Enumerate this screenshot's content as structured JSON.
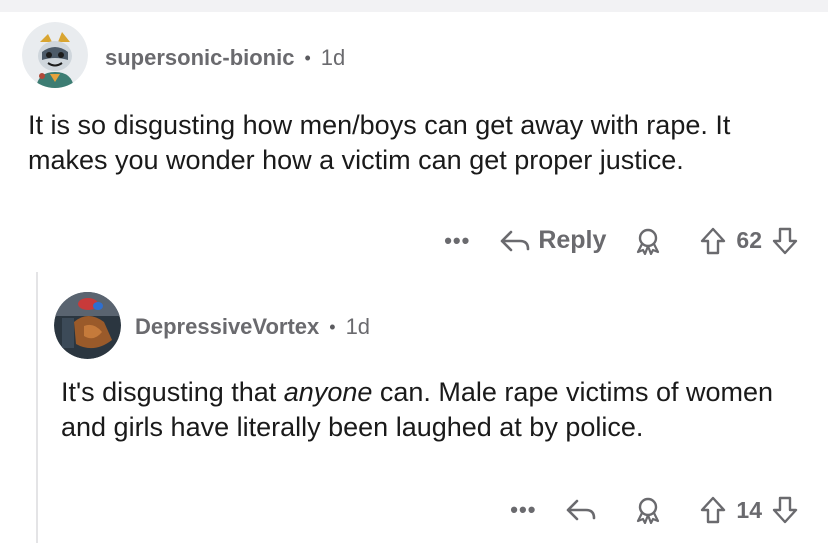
{
  "comments": [
    {
      "username": "supersonic-bionic",
      "separator": "•",
      "age": "1d",
      "text": "It is so disgusting how men/boys can get away with rape. It makes you wonder how a victim can get proper justice.",
      "more_label": "•••",
      "reply_label": "Reply",
      "score": "62"
    },
    {
      "username": "DepressiveVortex",
      "separator": "•",
      "age": "1d",
      "text_before": "It's disgusting that ",
      "text_em": "anyone",
      "text_after": " can. Male rape victims of women and girls have literally been laughed at by police.",
      "more_label": "•••",
      "score": "14"
    }
  ],
  "icons": {
    "reply": "reply-arrow-icon",
    "award": "award-icon",
    "upvote": "upvote-arrow-icon",
    "downvote": "downvote-arrow-icon"
  },
  "colors": {
    "meta_text": "#6a6a6e",
    "thread_line": "#e4e4e6",
    "topbar": "#f2f2f4"
  }
}
